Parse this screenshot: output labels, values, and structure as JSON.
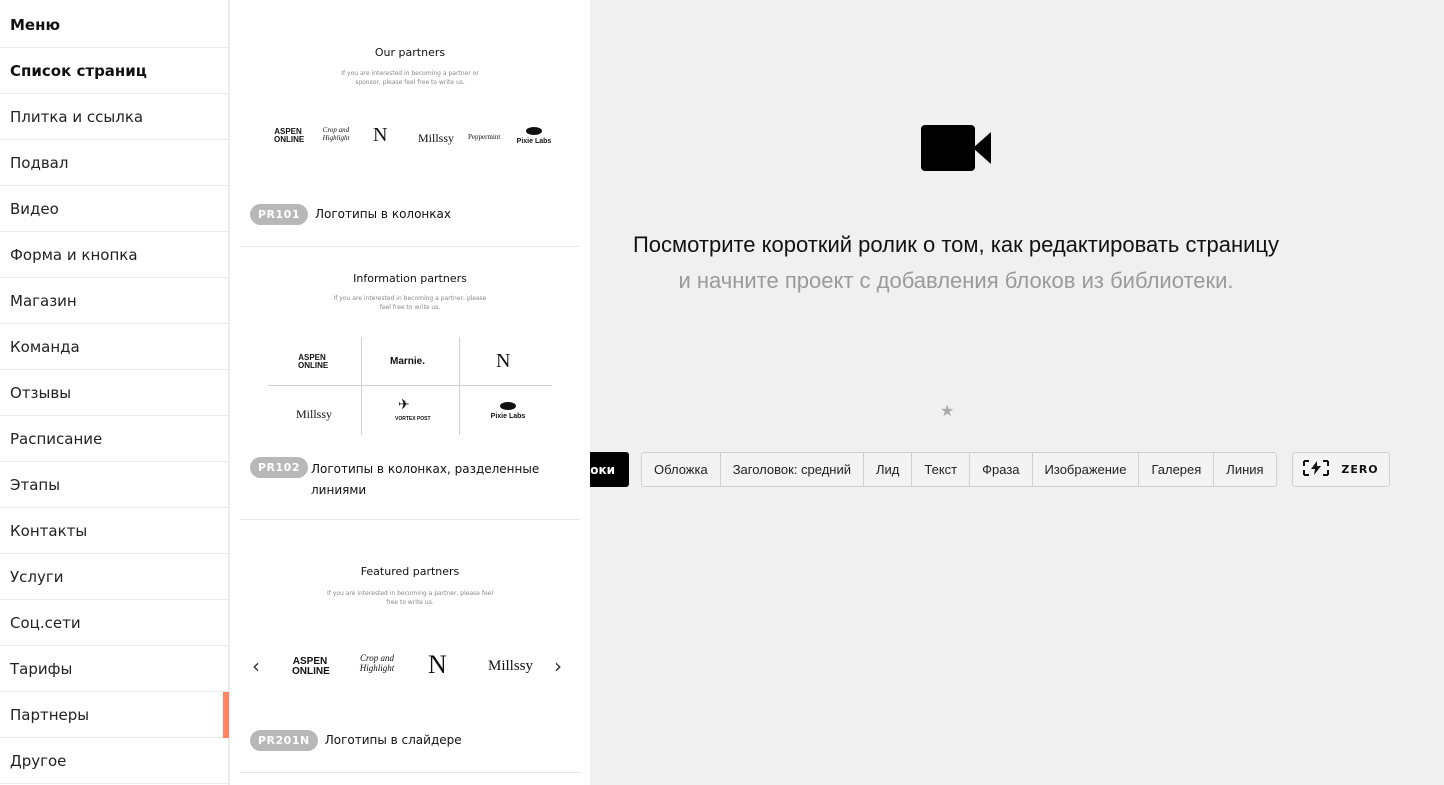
{
  "sidebar": {
    "items": [
      {
        "label": "Меню",
        "bold": true
      },
      {
        "label": "Список страниц",
        "bold": true
      },
      {
        "label": "Плитка и ссылка"
      },
      {
        "label": "Подвал"
      },
      {
        "label": "Видео"
      },
      {
        "label": "Форма и кнопка"
      },
      {
        "label": "Магазин"
      },
      {
        "label": "Команда"
      },
      {
        "label": "Отзывы"
      },
      {
        "label": "Расписание"
      },
      {
        "label": "Этапы"
      },
      {
        "label": "Контакты"
      },
      {
        "label": "Услуги"
      },
      {
        "label": "Соц.сети"
      },
      {
        "label": "Тарифы"
      },
      {
        "label": "Партнеры",
        "active": true
      },
      {
        "label": "Другое"
      }
    ],
    "active_color": "#ff8562"
  },
  "panel": {
    "cards": [
      {
        "preview_title": "Our partners",
        "preview_desc_1": "If you are interested in becoming a partner or",
        "preview_desc_2": "sponsor, please feel free to write us.",
        "logos": [
          "ASPEN ONLINE",
          "Crop and Highlight",
          "N",
          "Millssy",
          "Peppermint",
          "Pixie Labs"
        ],
        "code": "PR101",
        "name": "Логотипы в колонках"
      },
      {
        "preview_title": "Information partners",
        "preview_desc_1": "If you are interested in becoming a partner, please",
        "preview_desc_2": "feel free to write us.",
        "logos": [
          "ASPEN ONLINE",
          "Marnie.",
          "N",
          "Millssy",
          "VORTEX POST",
          "Pixie Labs"
        ],
        "code": "PR102",
        "name": "Логотипы в колонках, разделенные линиями"
      },
      {
        "preview_title": "Featured partners",
        "preview_desc_1": "If you are interested in becoming a partner, please feel",
        "preview_desc_2": "free to write us.",
        "logos": [
          "ASPEN ONLINE",
          "Crop and Highlight",
          "N",
          "Millssy"
        ],
        "code": "PR201N",
        "name": "Логотипы в слайдере"
      }
    ]
  },
  "main": {
    "icon": "video-camera-icon",
    "heading_primary": "Посмотрите короткий ролик о том, как редактировать страницу",
    "heading_secondary": "и начните проект с добавления блоков из библиотеки.",
    "all_blocks_label": "оки",
    "quick_blocks": [
      "Обложка",
      "Заголовок: средний",
      "Лид",
      "Текст",
      "Фраза",
      "Изображение",
      "Галерея",
      "Линия"
    ],
    "zero_label": "ZERO",
    "star_icon": "star-icon"
  }
}
